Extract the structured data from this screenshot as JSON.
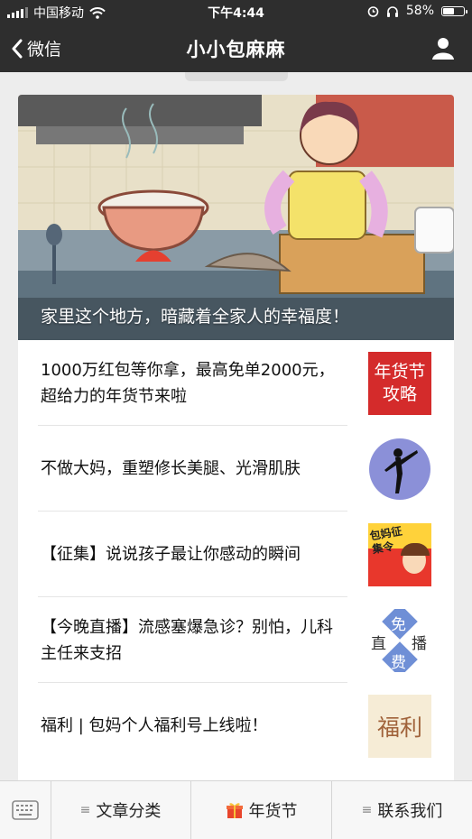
{
  "status": {
    "carrier": "中国移动",
    "time": "下午4:44",
    "battery": "58%",
    "battery_level": 0.58
  },
  "nav": {
    "back_label": "微信",
    "title": "小小包麻麻"
  },
  "cover": {
    "caption": "家里这个地方，暗藏着全家人的幸福度！"
  },
  "articles": [
    {
      "title": "1000万红包等你拿，最高免单2000元，超给力的年货节来啦",
      "thumb_text": "年货节攻略"
    },
    {
      "title": "不做大妈，重塑修长美腿、光滑肌肤"
    },
    {
      "title": "【征集】说说孩子最让你感动的瞬间",
      "thumb_text": "包妈征集令"
    },
    {
      "title": "【今晚直播】流感塞爆急诊？别怕，儿科主任来支招",
      "thumb_chars": [
        "免",
        "直",
        "播",
        "费"
      ]
    },
    {
      "title": "福利 | 包妈个人福利号上线啦！",
      "thumb_text": "福利"
    }
  ],
  "tabbar": {
    "tab1": "文章分类",
    "tab2": "年货节",
    "tab3": "联系我们"
  },
  "colors": {
    "bar": "#2e2e2e",
    "accent_red": "#d42b2b"
  }
}
